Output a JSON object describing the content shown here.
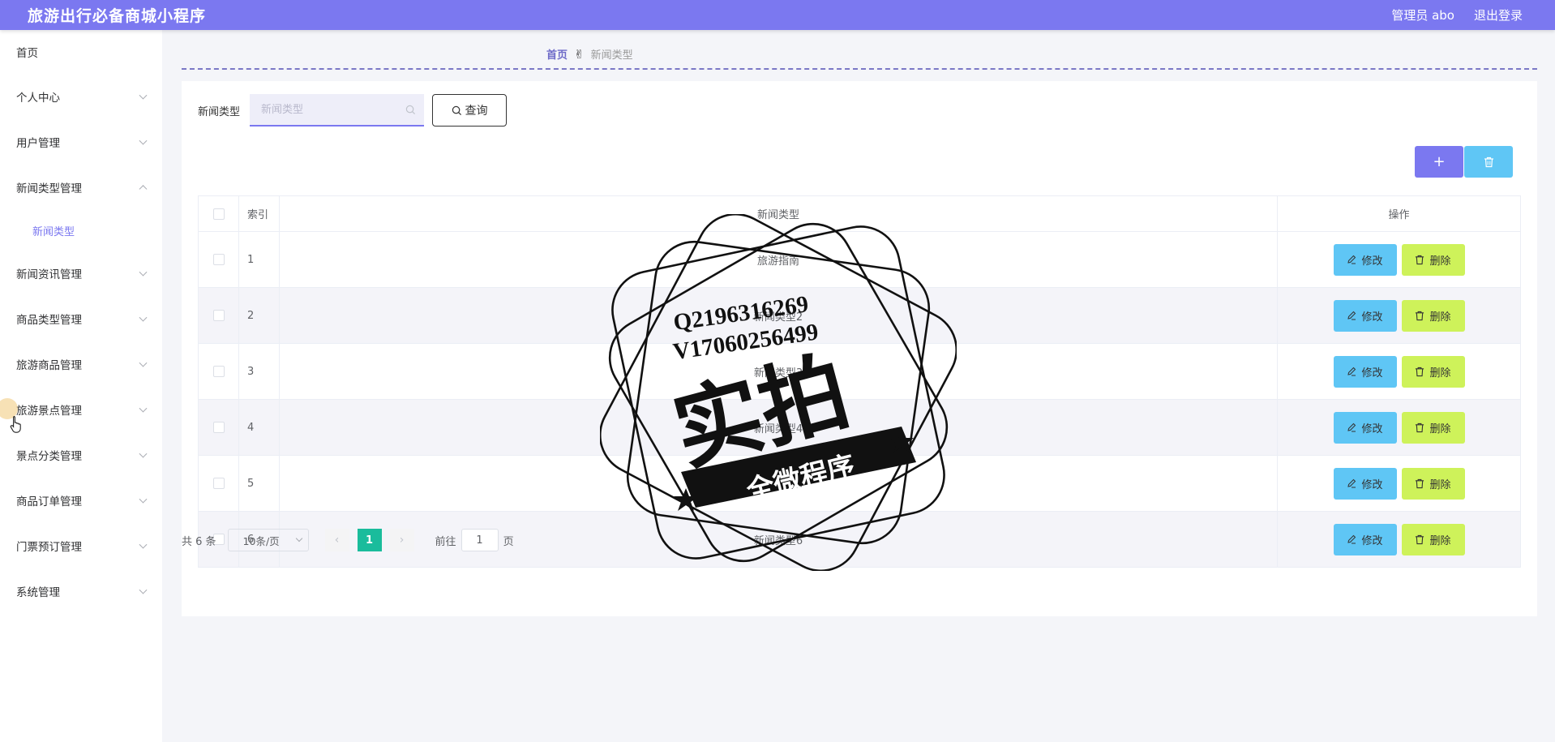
{
  "header": {
    "title": "旅游出行必备商城小程序",
    "user_label": "管理员 abo",
    "logout_label": "退出登录"
  },
  "sidebar": {
    "home": "首页",
    "items": [
      {
        "label": "个人中心",
        "expanded": false
      },
      {
        "label": "用户管理",
        "expanded": false
      },
      {
        "label": "新闻类型管理",
        "expanded": true
      },
      {
        "label": "新闻资讯管理",
        "expanded": false
      },
      {
        "label": "商品类型管理",
        "expanded": false
      },
      {
        "label": "旅游商品管理",
        "expanded": false
      },
      {
        "label": "旅游景点管理",
        "expanded": false
      },
      {
        "label": "景点分类管理",
        "expanded": false
      },
      {
        "label": "商品订单管理",
        "expanded": false
      },
      {
        "label": "门票预订管理",
        "expanded": false
      },
      {
        "label": "系统管理",
        "expanded": false
      }
    ],
    "submenu_label": "新闻类型"
  },
  "breadcrumb": {
    "home": "首页",
    "hand": "✌",
    "current": "新闻类型"
  },
  "search": {
    "label": "新闻类型",
    "placeholder": "新闻类型",
    "value": "",
    "button_label": "查询"
  },
  "toolbar": {
    "add_icon": "plus-icon",
    "delete_icon": "trash-icon"
  },
  "table": {
    "headers": {
      "index": "索引",
      "type": "新闻类型",
      "actions": "操作"
    },
    "rows": [
      {
        "index": "1",
        "type": "旅游指南"
      },
      {
        "index": "2",
        "type": "新闻类型2"
      },
      {
        "index": "3",
        "type": "新闻类型3"
      },
      {
        "index": "4",
        "type": "新闻类型4"
      },
      {
        "index": "5",
        "type": "新闻类型5"
      },
      {
        "index": "6",
        "type": "新闻类型6"
      }
    ],
    "edit_label": "修改",
    "delete_label": "删除"
  },
  "pagination": {
    "total_text": "共 6 条",
    "page_size": "10条/页",
    "current_page": "1",
    "goto_label": "前往",
    "goto_value": "1",
    "page_suffix": "页"
  },
  "watermark": {
    "line1": "Q2196316269",
    "line2": "V17060256499",
    "main": "实拍",
    "banner": "全微程序"
  },
  "colors": {
    "header": "#7b78f0",
    "accent": "#7b78f0",
    "edit": "#5fc6f5",
    "delete": "#cef25a",
    "page_active": "#1abc9c"
  }
}
